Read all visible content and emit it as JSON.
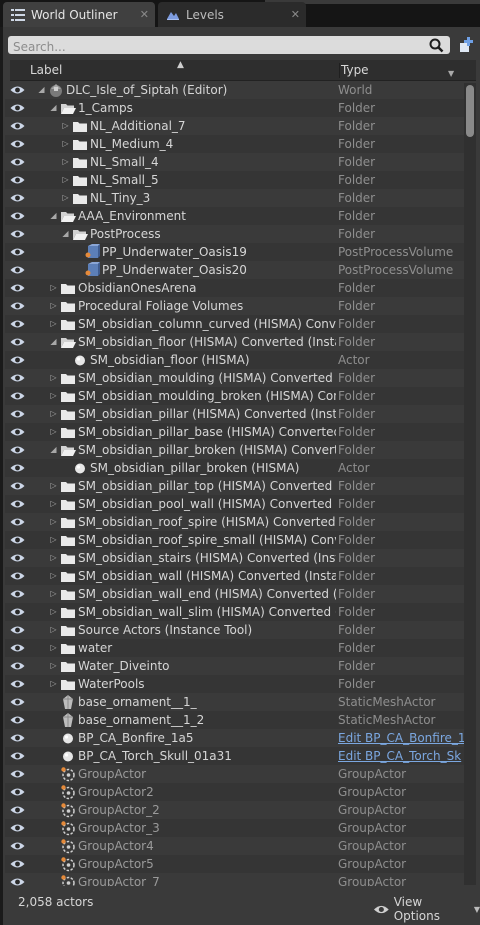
{
  "tabs": [
    {
      "label": "World Outliner",
      "icon": "outliner-icon",
      "active": true,
      "close": "✕"
    },
    {
      "label": "Levels",
      "icon": "levels-icon",
      "active": false,
      "close": "✕"
    }
  ],
  "search": {
    "placeholder": "Search..."
  },
  "columns": {
    "label": "Label",
    "type": "Type"
  },
  "rows": [
    {
      "label": "DLC_Isle_of_Siptah (Editor)",
      "type": "World",
      "indent": 0,
      "expand": "open",
      "icon": "world-icon"
    },
    {
      "label": "1_Camps",
      "type": "Folder",
      "indent": 1,
      "expand": "open",
      "icon": "folder-open-icon"
    },
    {
      "label": "NL_Additional_7",
      "type": "Folder",
      "indent": 2,
      "expand": "closed",
      "icon": "folder-icon"
    },
    {
      "label": "NL_Medium_4",
      "type": "Folder",
      "indent": 2,
      "expand": "closed",
      "icon": "folder-icon"
    },
    {
      "label": "NL_Small_4",
      "type": "Folder",
      "indent": 2,
      "expand": "closed",
      "icon": "folder-icon"
    },
    {
      "label": "NL_Small_5",
      "type": "Folder",
      "indent": 2,
      "expand": "closed",
      "icon": "folder-icon"
    },
    {
      "label": "NL_Tiny_3",
      "type": "Folder",
      "indent": 2,
      "expand": "closed",
      "icon": "folder-icon"
    },
    {
      "label": "AAA_Environment",
      "type": "Folder",
      "indent": 1,
      "expand": "open",
      "icon": "folder-open-icon"
    },
    {
      "label": "PostProcess",
      "type": "Folder",
      "indent": 2,
      "expand": "open",
      "icon": "folder-open-icon"
    },
    {
      "label": "PP_Underwater_Oasis19",
      "type": "PostProcessVolume",
      "indent": 3,
      "expand": "none",
      "icon": "postprocess-volume-icon"
    },
    {
      "label": "PP_Underwater_Oasis20",
      "type": "PostProcessVolume",
      "indent": 3,
      "expand": "none",
      "icon": "postprocess-volume-icon"
    },
    {
      "label": "ObsidianOnesArena",
      "type": "Folder",
      "indent": 1,
      "expand": "closed",
      "icon": "folder-icon"
    },
    {
      "label": "Procedural Foliage Volumes",
      "type": "Folder",
      "indent": 1,
      "expand": "closed",
      "icon": "folder-icon"
    },
    {
      "label": "SM_obsidian_column_curved (HISMA) Converted (Instance Tool)",
      "type": "Folder",
      "indent": 1,
      "expand": "closed",
      "icon": "folder-icon"
    },
    {
      "label": "SM_obsidian_floor (HISMA) Converted (Instance Tool)",
      "type": "Folder",
      "indent": 1,
      "expand": "open",
      "icon": "folder-open-icon"
    },
    {
      "label": "SM_obsidian_floor (HISMA)",
      "type": "Actor",
      "indent": 2,
      "expand": "none",
      "icon": "actor-sphere-icon"
    },
    {
      "label": "SM_obsidian_moulding (HISMA) Converted (Instance Tool)",
      "type": "Folder",
      "indent": 1,
      "expand": "closed",
      "icon": "folder-icon"
    },
    {
      "label": "SM_obsidian_moulding_broken (HISMA) Converted (Instance Tool)",
      "type": "Folder",
      "indent": 1,
      "expand": "closed",
      "icon": "folder-icon"
    },
    {
      "label": "SM_obsidian_pillar (HISMA) Converted (Instance Tool)",
      "type": "Folder",
      "indent": 1,
      "expand": "closed",
      "icon": "folder-icon"
    },
    {
      "label": "SM_obsidian_pillar_base (HISMA) Converted (Instance Tool)",
      "type": "Folder",
      "indent": 1,
      "expand": "closed",
      "icon": "folder-icon"
    },
    {
      "label": "SM_obsidian_pillar_broken (HISMA) Converted (Instance Tool)",
      "type": "Folder",
      "indent": 1,
      "expand": "open",
      "icon": "folder-open-icon"
    },
    {
      "label": "SM_obsidian_pillar_broken (HISMA)",
      "type": "Actor",
      "indent": 2,
      "expand": "none",
      "icon": "actor-sphere-icon"
    },
    {
      "label": "SM_obsidian_pillar_top (HISMA) Converted (Instance Tool)",
      "type": "Folder",
      "indent": 1,
      "expand": "closed",
      "icon": "folder-icon"
    },
    {
      "label": "SM_obsidian_pool_wall (HISMA) Converted (Instance Tool)",
      "type": "Folder",
      "indent": 1,
      "expand": "closed",
      "icon": "folder-icon"
    },
    {
      "label": "SM_obsidian_roof_spire (HISMA) Converted (Instance Tool)",
      "type": "Folder",
      "indent": 1,
      "expand": "closed",
      "icon": "folder-icon"
    },
    {
      "label": "SM_obsidian_roof_spire_small (HISMA) Converted (Instance Tool)",
      "type": "Folder",
      "indent": 1,
      "expand": "closed",
      "icon": "folder-icon"
    },
    {
      "label": "SM_obsidian_stairs (HISMA) Converted (Instance Tool)",
      "type": "Folder",
      "indent": 1,
      "expand": "closed",
      "icon": "folder-icon"
    },
    {
      "label": "SM_obsidian_wall (HISMA) Converted (Instance Tool)",
      "type": "Folder",
      "indent": 1,
      "expand": "closed",
      "icon": "folder-icon"
    },
    {
      "label": "SM_obsidian_wall_end (HISMA) Converted (Instance Tool)",
      "type": "Folder",
      "indent": 1,
      "expand": "closed",
      "icon": "folder-icon"
    },
    {
      "label": "SM_obsidian_wall_slim (HISMA) Converted (Instance Tool)",
      "type": "Folder",
      "indent": 1,
      "expand": "closed",
      "icon": "folder-icon"
    },
    {
      "label": "Source Actors (Instance Tool)",
      "type": "Folder",
      "indent": 1,
      "expand": "closed",
      "icon": "folder-icon"
    },
    {
      "label": "water",
      "type": "Folder",
      "indent": 1,
      "expand": "closed",
      "icon": "folder-icon"
    },
    {
      "label": "Water_Diveinto",
      "type": "Folder",
      "indent": 1,
      "expand": "closed",
      "icon": "folder-icon"
    },
    {
      "label": "WaterPools",
      "type": "Folder",
      "indent": 1,
      "expand": "closed",
      "icon": "folder-icon"
    },
    {
      "label": "base_ornament__1_",
      "type": "StaticMeshActor",
      "indent": 1,
      "expand": "none",
      "icon": "static-mesh-icon"
    },
    {
      "label": "base_ornament__1_2",
      "type": "StaticMeshActor",
      "indent": 1,
      "expand": "none",
      "icon": "static-mesh-icon"
    },
    {
      "label": "BP_CA_Bonfire_1a5",
      "type": "Edit BP_CA_Bonfire_1",
      "indent": 1,
      "expand": "none",
      "icon": "actor-sphere-icon",
      "type_link": true
    },
    {
      "label": "BP_CA_Torch_Skull_01a31",
      "type": "Edit BP_CA_Torch_Sk",
      "indent": 1,
      "expand": "none",
      "icon": "actor-sphere-icon",
      "type_link": true
    },
    {
      "label": "GroupActor",
      "type": "GroupActor",
      "indent": 1,
      "expand": "none",
      "icon": "group-actor-icon",
      "dim": true
    },
    {
      "label": "GroupActor2",
      "type": "GroupActor",
      "indent": 1,
      "expand": "none",
      "icon": "group-actor-icon",
      "dim": true
    },
    {
      "label": "GroupActor_2",
      "type": "GroupActor",
      "indent": 1,
      "expand": "none",
      "icon": "group-actor-icon",
      "dim": true
    },
    {
      "label": "GroupActor_3",
      "type": "GroupActor",
      "indent": 1,
      "expand": "none",
      "icon": "group-actor-icon",
      "dim": true
    },
    {
      "label": "GroupActor4",
      "type": "GroupActor",
      "indent": 1,
      "expand": "none",
      "icon": "group-actor-icon",
      "dim": true
    },
    {
      "label": "GroupActor5",
      "type": "GroupActor",
      "indent": 1,
      "expand": "none",
      "icon": "group-actor-icon",
      "dim": true
    },
    {
      "label": "GroupActor_7",
      "type": "GroupActor",
      "indent": 1,
      "expand": "none",
      "icon": "group-actor-icon",
      "dim": true
    }
  ],
  "footer": {
    "count": "2,058 actors",
    "view_options": "View Options"
  }
}
